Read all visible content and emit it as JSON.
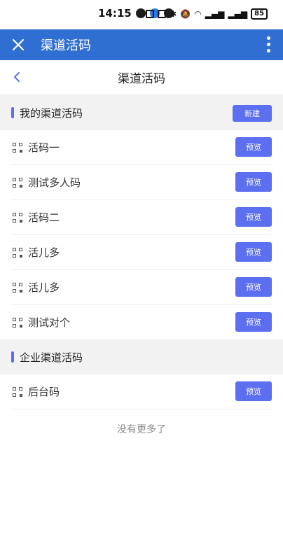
{
  "status": {
    "time": "14:15",
    "battery": "85"
  },
  "appbar": {
    "title": "渠道活码"
  },
  "page": {
    "title": "渠道活码"
  },
  "my_section": {
    "title": "我的渠道活码",
    "new_label": "新建",
    "items": [
      {
        "name": "活码一",
        "action": "预览"
      },
      {
        "name": "测试多人码",
        "action": "预览"
      },
      {
        "name": "活码二",
        "action": "预览"
      },
      {
        "name": "活儿多",
        "action": "预览"
      },
      {
        "name": "活儿多",
        "action": "预览"
      },
      {
        "name": "测试对个",
        "action": "预览"
      }
    ]
  },
  "enterprise_section": {
    "title": "企业渠道活码",
    "items": [
      {
        "name": "后台码",
        "action": "预览"
      }
    ]
  },
  "footer": {
    "no_more": "没有更多了"
  },
  "colors": {
    "appbar": "#2f6fd1",
    "accent": "#5b6ff0"
  }
}
